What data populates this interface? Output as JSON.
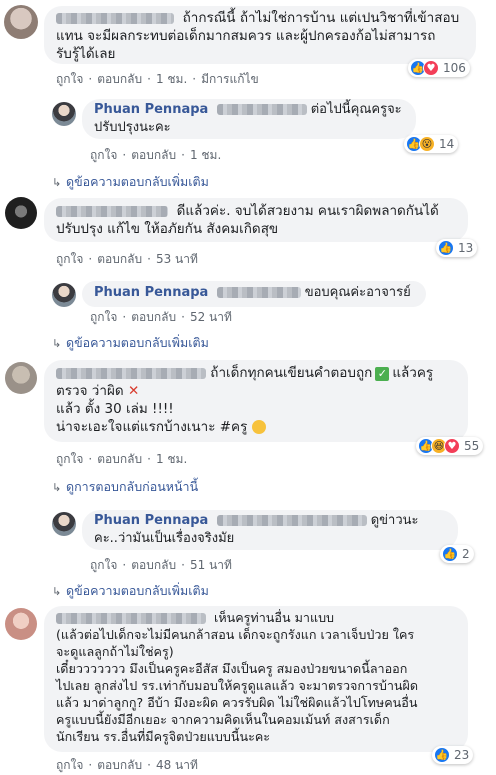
{
  "comments": [
    {
      "text_lines": [
        "ถ้ากรณีนี้ ถ้าไม่ใช่การบ้าน แต่เปนวิชาที่เข้าสอบ",
        "แทน จะมีผลกระทบต่อเด็กมากสมควร และผู้ปกครองก้อไม่สามารถ",
        "รับรู้ได้เลย"
      ],
      "actions": {
        "like": "ถูกใจ",
        "reply": "ตอบกลับ",
        "time": "1 ชม.",
        "edited": "มีการแก้ไข"
      },
      "reactions_count": "106",
      "reply": {
        "author": "Phuan Pennapa",
        "text_lines": [
          "ต่อไปนี้คุณครูจะ",
          "ปรับปรุงนะคะ"
        ],
        "actions": {
          "like": "ถูกใจ",
          "reply": "ตอบกลับ",
          "time": "1 ชม."
        },
        "reactions_count": "14"
      },
      "more_replies": "ดูข้อความตอบกลับเพิ่มเติม"
    },
    {
      "text_lines": [
        "ดีแล้วค่ะ. จบได้สวยงาม คนเราผิดพลาดกันได้",
        "ปรับปรุง แก้ไข ให้อภัยกัน สังคมเกิดสุข"
      ],
      "actions": {
        "like": "ถูกใจ",
        "reply": "ตอบกลับ",
        "time": "53 นาที"
      },
      "reactions_count": "13",
      "reply": {
        "author": "Phuan Pennapa",
        "text_lines": [
          "ขอบคุณค่ะอาจารย์"
        ],
        "actions": {
          "like": "ถูกใจ",
          "reply": "ตอบกลับ",
          "time": "52 นาที"
        }
      },
      "more_replies": "ดูข้อความตอบกลับเพิ่มเติม"
    },
    {
      "text_lines": [
        "ถ้าเด็กทุกคนเขียนคำตอบถูก",
        "แล้วครู",
        "ตรวจ ว่าผิด",
        "แล้ว ตั้ง 30 เล่ม !!!!",
        "น่าจะเอะใจแต่แรกบ้างเนาะ #ครู"
      ],
      "actions": {
        "like": "ถูกใจ",
        "reply": "ตอบกลับ",
        "time": "1 ชม."
      },
      "reactions_count": "55",
      "previous_replies": "ดูการตอบกลับก่อนหน้านี้",
      "reply": {
        "author": "Phuan Pennapa",
        "text_lines": [
          "ดูข่าวนะ",
          "คะ..ว่ามันเป็นเรื่องจริงมัย"
        ],
        "actions": {
          "like": "ถูกใจ",
          "reply": "ตอบกลับ",
          "time": "51 นาที"
        },
        "reactions_count": "2"
      },
      "more_replies": "ดูข้อความตอบกลับเพิ่มเติม"
    },
    {
      "text_lines": [
        "เห็นครูท่านอื่น มาแบบ",
        "(แล้วต่อไปเด็กจะไม่มีคนกล้าสอน เด็กจะถูกรังแก เวลาเจ็บป่วย ใคร",
        "จะดูแลลูกถ้าไม่ใช่ครู)",
        "เดี๋ยววววววว มึงเป็นครูคะอีสัส มึงเป็นครู สมองป่วยขนาดนี้ลาออก",
        "ไปเลย ลูกส่งไป รร.เท่ากับมอบให้ครูดูแลแล้ว จะมาตรวจการบ้านผิด",
        "แล้ว มาด่าลูกกู? อีบ้า มึงอะผิด ควรรับผิด ไม่ใช่ผิดแล้วไปโทษคนอื่น",
        "ครูแบบนี้ยังมีอีกเยอะ จากความคิดเห็นในคอมเม้นท์ สงสารเด็ก",
        "นักเรียน รร.อื่นที่มีครูจิตป่วยแบบนี้นะคะ"
      ],
      "actions": {
        "like": "ถูกใจ",
        "reply": "ตอบกลับ",
        "time": "48 นาที"
      },
      "reactions_count": "23"
    }
  ]
}
